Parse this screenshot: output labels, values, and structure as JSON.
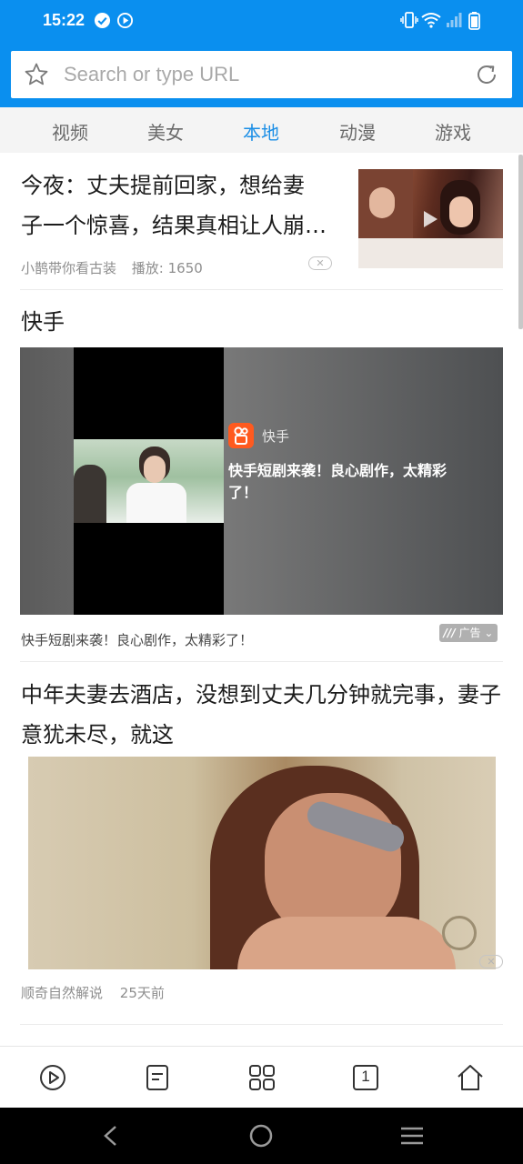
{
  "status_bar": {
    "time": "15:22"
  },
  "address_bar": {
    "placeholder": "Search or type URL",
    "value": ""
  },
  "tabs": [
    {
      "label": "视频"
    },
    {
      "label": "美女"
    },
    {
      "label": "本地"
    },
    {
      "label": "动漫"
    },
    {
      "label": "游戏"
    }
  ],
  "active_tab_index": 2,
  "feed": {
    "article_1": {
      "title_line1": "今夜：丈夫提前回家，想给妻",
      "title_line2": "子一个惊喜，结果真相让人崩…",
      "source": "小鹊带你看古装",
      "plays": "播放: 1650"
    },
    "ad": {
      "heading": "快手",
      "brand": "快手",
      "caption": "快手短剧来袭！良心剧作，太精彩了！",
      "description": "快手短剧来袭！良心剧作，太精彩了！",
      "tag": "广告"
    },
    "article_3": {
      "title": "中年夫妻去酒店，没想到丈夫几分钟就完事，妻子意犹未尽，就这",
      "source": "顺奇自然解说",
      "time": "25天前"
    }
  },
  "colors": {
    "brand_blue": "#0a8fef",
    "active_tab": "#1a8ee6"
  },
  "icons": {
    "url_left": "star-icon",
    "url_right": "refresh-icon",
    "nav": [
      "play-icon",
      "list-icon",
      "grid-icon",
      "tabs-icon",
      "home-icon"
    ],
    "system": [
      "back-icon",
      "home-circle-icon",
      "menu-icon"
    ]
  },
  "bottom_nav": {
    "tab_count": "1"
  }
}
